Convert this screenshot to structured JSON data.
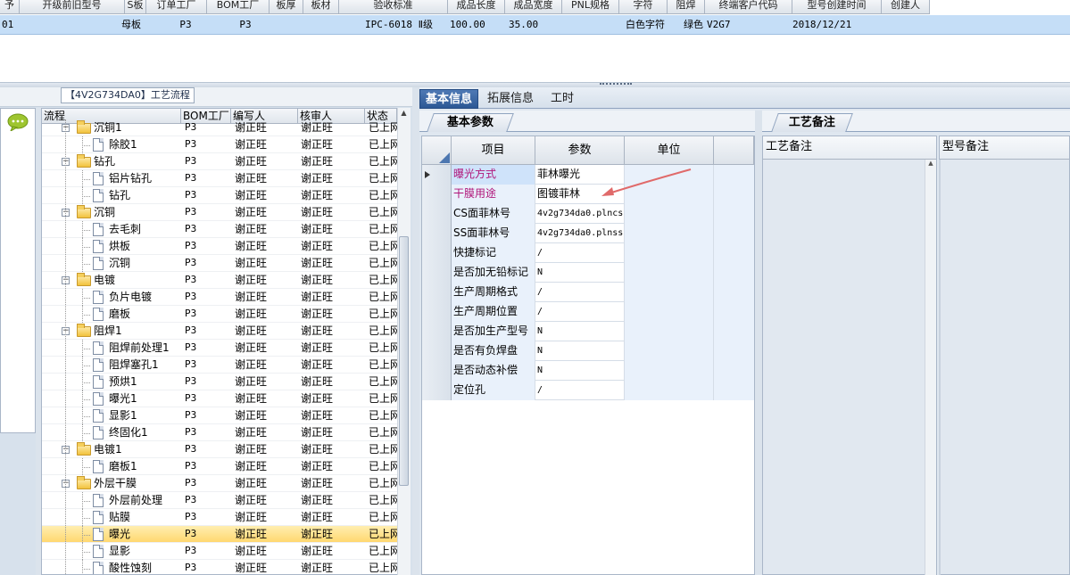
{
  "top_grid": {
    "headers": [
      "予",
      "开级前旧型号",
      "S板",
      "订单工厂",
      "BOM工厂",
      "板厚",
      "板材",
      "验收标准",
      "成品长度",
      "成品宽度",
      "PNL规格",
      "字符",
      "阻焊",
      "终端客户代码",
      "型号创建时间",
      "创建人"
    ],
    "row": [
      "01",
      "",
      "母板",
      "P3",
      "P3",
      "",
      "",
      "IPC-6018 Ⅱ级",
      "100.00",
      "35.00",
      "",
      "白色字符",
      "绿色",
      "V2G7",
      "2018/12/21",
      ""
    ]
  },
  "left_panel": {
    "title": "【4V2G734DA0】工艺流程",
    "tree_headers": [
      "流程",
      "BOM工厂",
      "编写人",
      "核审人",
      "状态"
    ],
    "rows": [
      {
        "name": "沉铜1",
        "level": 0,
        "type": "folder",
        "expanded": true,
        "bom": "P3",
        "writer": "谢正旺",
        "reviewer": "谢正旺",
        "status": "已上网"
      },
      {
        "name": "除胶1",
        "level": 1,
        "type": "doc",
        "bom": "P3",
        "writer": "谢正旺",
        "reviewer": "谢正旺",
        "status": "已上网"
      },
      {
        "name": "钻孔",
        "level": 0,
        "type": "folder",
        "expanded": true,
        "bom": "P3",
        "writer": "谢正旺",
        "reviewer": "谢正旺",
        "status": "已上网"
      },
      {
        "name": "铝片钻孔",
        "level": 1,
        "type": "doc",
        "bom": "P3",
        "writer": "谢正旺",
        "reviewer": "谢正旺",
        "status": "已上网"
      },
      {
        "name": "钻孔",
        "level": 1,
        "type": "doc",
        "bom": "P3",
        "writer": "谢正旺",
        "reviewer": "谢正旺",
        "status": "已上网"
      },
      {
        "name": "沉铜",
        "level": 0,
        "type": "folder",
        "expanded": true,
        "bom": "P3",
        "writer": "谢正旺",
        "reviewer": "谢正旺",
        "status": "已上网"
      },
      {
        "name": "去毛刺",
        "level": 1,
        "type": "doc",
        "bom": "P3",
        "writer": "谢正旺",
        "reviewer": "谢正旺",
        "status": "已上网"
      },
      {
        "name": "烘板",
        "level": 1,
        "type": "doc",
        "bom": "P3",
        "writer": "谢正旺",
        "reviewer": "谢正旺",
        "status": "已上网"
      },
      {
        "name": "沉铜",
        "level": 1,
        "type": "doc",
        "bom": "P3",
        "writer": "谢正旺",
        "reviewer": "谢正旺",
        "status": "已上网"
      },
      {
        "name": "电镀",
        "level": 0,
        "type": "folder",
        "expanded": true,
        "bom": "P3",
        "writer": "谢正旺",
        "reviewer": "谢正旺",
        "status": "已上网"
      },
      {
        "name": "负片电镀",
        "level": 1,
        "type": "doc",
        "bom": "P3",
        "writer": "谢正旺",
        "reviewer": "谢正旺",
        "status": "已上网"
      },
      {
        "name": "磨板",
        "level": 1,
        "type": "doc",
        "bom": "P3",
        "writer": "谢正旺",
        "reviewer": "谢正旺",
        "status": "已上网"
      },
      {
        "name": "阻焊1",
        "level": 0,
        "type": "folder",
        "expanded": true,
        "bom": "P3",
        "writer": "谢正旺",
        "reviewer": "谢正旺",
        "status": "已上网"
      },
      {
        "name": "阻焊前处理1",
        "level": 1,
        "type": "doc",
        "bom": "P3",
        "writer": "谢正旺",
        "reviewer": "谢正旺",
        "status": "已上网"
      },
      {
        "name": "阻焊塞孔1",
        "level": 1,
        "type": "doc",
        "bom": "P3",
        "writer": "谢正旺",
        "reviewer": "谢正旺",
        "status": "已上网"
      },
      {
        "name": "预烘1",
        "level": 1,
        "type": "doc",
        "bom": "P3",
        "writer": "谢正旺",
        "reviewer": "谢正旺",
        "status": "已上网"
      },
      {
        "name": "曝光1",
        "level": 1,
        "type": "doc",
        "bom": "P3",
        "writer": "谢正旺",
        "reviewer": "谢正旺",
        "status": "已上网"
      },
      {
        "name": "显影1",
        "level": 1,
        "type": "doc",
        "bom": "P3",
        "writer": "谢正旺",
        "reviewer": "谢正旺",
        "status": "已上网"
      },
      {
        "name": "终固化1",
        "level": 1,
        "type": "doc",
        "bom": "P3",
        "writer": "谢正旺",
        "reviewer": "谢正旺",
        "status": "已上网"
      },
      {
        "name": "电镀1",
        "level": 0,
        "type": "folder",
        "expanded": true,
        "bom": "P3",
        "writer": "谢正旺",
        "reviewer": "谢正旺",
        "status": "已上网"
      },
      {
        "name": "磨板1",
        "level": 1,
        "type": "doc",
        "bom": "P3",
        "writer": "谢正旺",
        "reviewer": "谢正旺",
        "status": "已上网"
      },
      {
        "name": "外层干膜",
        "level": 0,
        "type": "folder",
        "expanded": true,
        "bom": "P3",
        "writer": "谢正旺",
        "reviewer": "谢正旺",
        "status": "已上网"
      },
      {
        "name": "外层前处理",
        "level": 1,
        "type": "doc",
        "bom": "P3",
        "writer": "谢正旺",
        "reviewer": "谢正旺",
        "status": "已上网"
      },
      {
        "name": "贴膜",
        "level": 1,
        "type": "doc",
        "bom": "P3",
        "writer": "谢正旺",
        "reviewer": "谢正旺",
        "status": "已上网"
      },
      {
        "name": "曝光",
        "level": 1,
        "type": "doc",
        "selected": true,
        "bom": "P3",
        "writer": "谢正旺",
        "reviewer": "谢正旺",
        "status": "已上网"
      },
      {
        "name": "显影",
        "level": 1,
        "type": "doc",
        "bom": "P3",
        "writer": "谢正旺",
        "reviewer": "谢正旺",
        "status": "已上网"
      },
      {
        "name": "酸性蚀刻",
        "level": 1,
        "type": "doc",
        "bom": "P3",
        "writer": "谢正旺",
        "reviewer": "谢正旺",
        "status": "已上网"
      }
    ]
  },
  "middle_panel": {
    "tabs": [
      "基本信息",
      "拓展信息",
      "工时"
    ],
    "active_tab": 0,
    "subtab": "基本参数",
    "grid_headers": [
      "项目",
      "参数",
      "单位"
    ],
    "params": [
      {
        "name": "曝光方式",
        "value": "菲林曝光",
        "unit": "",
        "highlight": true,
        "current": true
      },
      {
        "name": "干膜用途",
        "value": "图镀菲林",
        "unit": "",
        "highlight": true
      },
      {
        "name": "CS面菲林号",
        "value": "4v2g734da0.plncs",
        "unit": ""
      },
      {
        "name": "SS面菲林号",
        "value": "4v2g734da0.plnss",
        "unit": ""
      },
      {
        "name": "快捷标记",
        "value": "/",
        "unit": ""
      },
      {
        "name": "是否加无铅标记",
        "value": "N",
        "unit": ""
      },
      {
        "name": "生产周期格式",
        "value": "/",
        "unit": ""
      },
      {
        "name": "生产周期位置",
        "value": "/",
        "unit": ""
      },
      {
        "name": "是否加生产型号",
        "value": "N",
        "unit": ""
      },
      {
        "name": "是否有负焊盘",
        "value": "N",
        "unit": ""
      },
      {
        "name": "是否动态补偿",
        "value": "N",
        "unit": ""
      },
      {
        "name": "定位孔",
        "value": "/",
        "unit": ""
      }
    ]
  },
  "right_panel": {
    "tab": "工艺备注",
    "col1_header": "工艺备注",
    "col2_header": "型号备注"
  },
  "colors": {
    "selection_row": "#c5def7",
    "tab_active": "#2c5895",
    "highlight_text": "#b0157a",
    "annotation_arrow": "#e06a6a"
  }
}
